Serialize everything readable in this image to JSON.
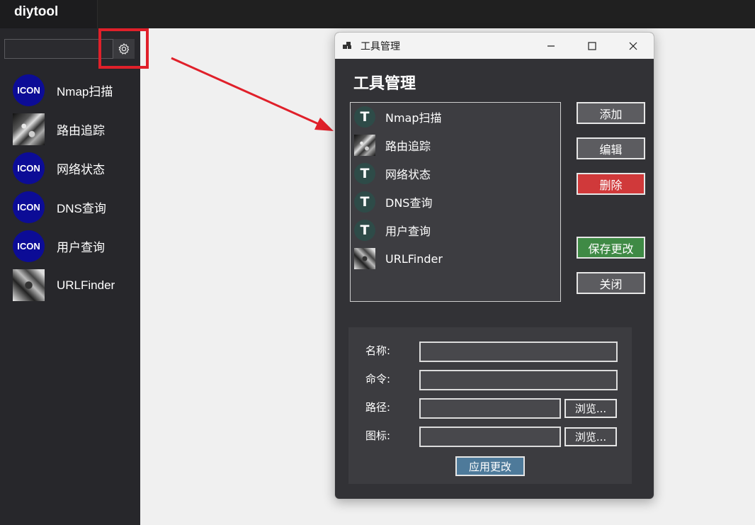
{
  "app": {
    "title": "diytool"
  },
  "sidebar": {
    "search": {
      "value": "",
      "placeholder": ""
    },
    "tools": [
      {
        "label": "Nmap扫描",
        "icon": "ICON",
        "icon_type": "circle"
      },
      {
        "label": "路由追踪",
        "icon": "image-thumbnail",
        "icon_type": "image"
      },
      {
        "label": "网络状态",
        "icon": "ICON",
        "icon_type": "circle"
      },
      {
        "label": "DNS查询",
        "icon": "ICON",
        "icon_type": "circle"
      },
      {
        "label": "用户查询",
        "icon": "ICON",
        "icon_type": "circle"
      },
      {
        "label": "URLFinder",
        "icon": "image-thumbnail",
        "icon_type": "image"
      }
    ]
  },
  "dialog": {
    "window_title": "工具管理",
    "heading": "工具管理",
    "list": [
      {
        "label": "Nmap扫描",
        "icon": "T"
      },
      {
        "label": "路由追踪",
        "icon": "image-thumbnail"
      },
      {
        "label": "网络状态",
        "icon": "T"
      },
      {
        "label": "DNS查询",
        "icon": "T"
      },
      {
        "label": "用户查询",
        "icon": "T"
      },
      {
        "label": "URLFinder",
        "icon": "image-thumbnail"
      }
    ],
    "buttons": {
      "add": "添加",
      "edit": "编辑",
      "delete": "删除",
      "save": "保存更改",
      "close": "关闭",
      "apply": "应用更改",
      "browse_path": "浏览...",
      "browse_icon": "浏览..."
    },
    "form": {
      "name_label": "名称:",
      "name_value": "",
      "command_label": "命令:",
      "command_value": "",
      "path_label": "路径:",
      "path_value": "",
      "icon_label": "图标:",
      "icon_value": ""
    }
  },
  "colors": {
    "accent_red": "#e0202a",
    "delete_red": "#d0393a",
    "save_green": "#3f8a45",
    "apply_blue": "#4e7a9a",
    "icon_blue": "#0c0c96"
  }
}
